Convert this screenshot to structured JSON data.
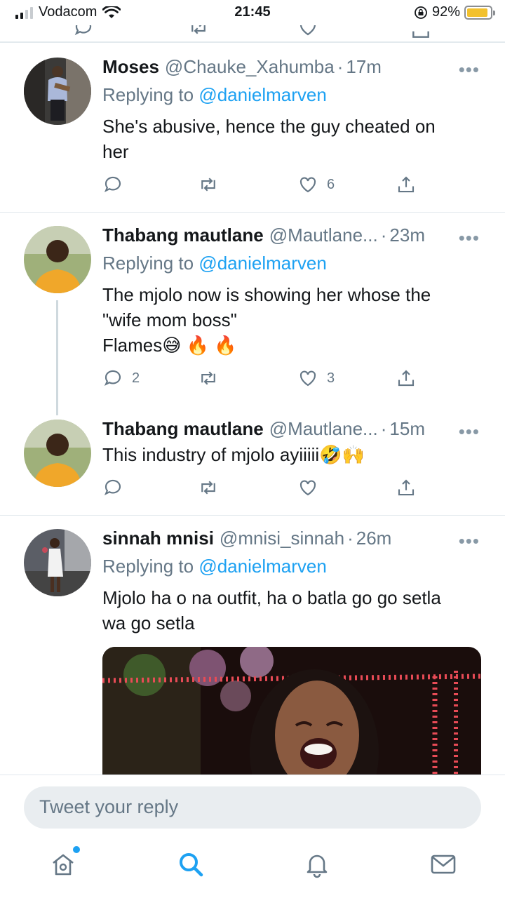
{
  "status_bar": {
    "carrier": "Vodacom",
    "time": "21:45",
    "battery_percent": "92%",
    "battery_level": 0.92,
    "icons": [
      "signal-icon",
      "wifi-icon",
      "rotation-lock-icon",
      "battery-icon"
    ]
  },
  "tweets": [
    {
      "name": "Moses",
      "handle": "@Chauke_Xahumba",
      "separator": "·",
      "time": "17m",
      "replying_prefix": "Replying to",
      "replying_to": "@danielmarven",
      "text_lines": [
        "She's abusive, hence the guy cheated on",
        "her"
      ],
      "reply_count": "",
      "retweet_count": "",
      "like_count": "6"
    },
    {
      "name": "Thabang mautlane",
      "handle": "@Mautlane...",
      "separator": "·",
      "time": "23m",
      "replying_prefix": "Replying to",
      "replying_to": "@danielmarven",
      "text_lines": [
        "The mjolo now is showing her whose the",
        "\"wife mom boss\"",
        "Flames😅 🔥 🔥"
      ],
      "reply_count": "2",
      "retweet_count": "",
      "like_count": "3"
    },
    {
      "name": "Thabang mautlane",
      "handle": "@Mautlane...",
      "separator": "·",
      "time": "15m",
      "text_lines": [
        "This industry of mjolo ayiiiii🤣🙌"
      ],
      "reply_count": "",
      "retweet_count": "",
      "like_count": ""
    },
    {
      "name": "sinnah mnisi",
      "handle": "@mnisi_sinnah",
      "separator": "·",
      "time": "26m",
      "replying_prefix": "Replying to",
      "replying_to": "@danielmarven",
      "text_lines": [
        "Mjolo ha o na outfit, ha o batla go go setla",
        "wa go setla"
      ]
    }
  ],
  "more_glyph": "•••",
  "reply_bar": {
    "placeholder": "Tweet your reply"
  },
  "tab_bar": {
    "tabs": [
      "home-icon",
      "search-icon",
      "notifications-icon",
      "messages-icon"
    ],
    "active": "search-icon",
    "accent_color": "#1da1f2"
  }
}
